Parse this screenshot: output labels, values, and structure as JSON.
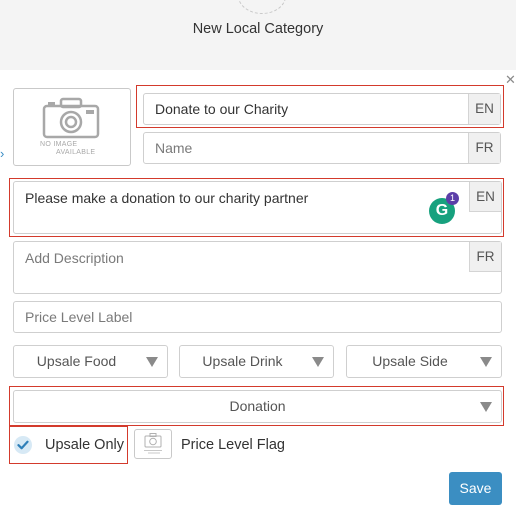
{
  "dialog": {
    "title": "New Local Category",
    "no_image": {
      "line1": "NO IMAGE",
      "line2": "AVAILABLE"
    }
  },
  "fields": {
    "name_en": {
      "value": "Donate to our Charity",
      "lang": "EN"
    },
    "name_fr": {
      "placeholder": "Name",
      "lang": "FR"
    },
    "desc_en": {
      "value": "Please make a donation to our charity partner",
      "lang": "EN"
    },
    "desc_fr": {
      "placeholder": "Add Description",
      "lang": "FR"
    },
    "price_level_label": {
      "placeholder": "Price Level Label"
    }
  },
  "selects": {
    "upsale_food": "Upsale Food",
    "upsale_drink": "Upsale Drink",
    "upsale_side": "Upsale Side",
    "category_type": "Donation"
  },
  "grammarly": {
    "letter": "G",
    "badge": "1"
  },
  "options": {
    "upsale_only": {
      "label": "Upsale Only",
      "checked": true
    },
    "price_level_flag": {
      "label": "Price Level Flag"
    }
  },
  "actions": {
    "save": "Save"
  },
  "colors": {
    "accent": "#3b8ec2",
    "highlight": "#d33a2c",
    "grammarly": "#17a17e"
  },
  "icons": [
    "close-icon",
    "chevron-left-icon",
    "camera-icon",
    "grammarly-icon",
    "check-icon",
    "caret-down-icon"
  ]
}
